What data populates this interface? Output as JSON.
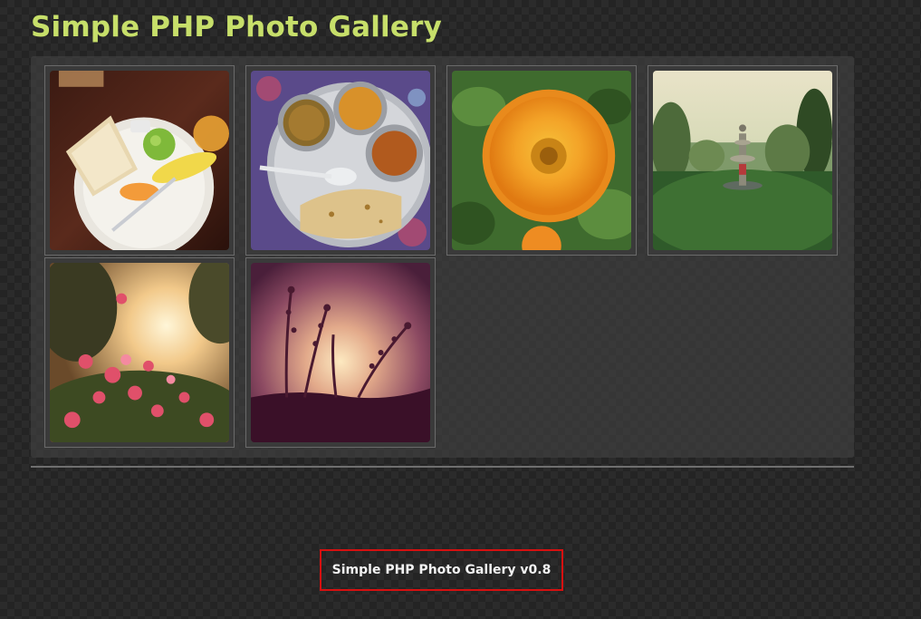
{
  "header": {
    "title": "Simple PHP Photo Gallery"
  },
  "gallery": {
    "items": [
      {
        "icon": "breakfast-photo"
      },
      {
        "icon": "thali-meal-photo"
      },
      {
        "icon": "marigold-flower-photo"
      },
      {
        "icon": "garden-fountain-photo"
      },
      {
        "icon": "bougainvillea-sunset-photo"
      },
      {
        "icon": "plant-silhouette-sunset-photo"
      }
    ]
  },
  "footer": {
    "credit": "Simple PHP Photo Gallery v0.8"
  },
  "colors": {
    "title": "#c7df6a",
    "footer_highlight_border": "#d71010",
    "background": "#242424"
  }
}
